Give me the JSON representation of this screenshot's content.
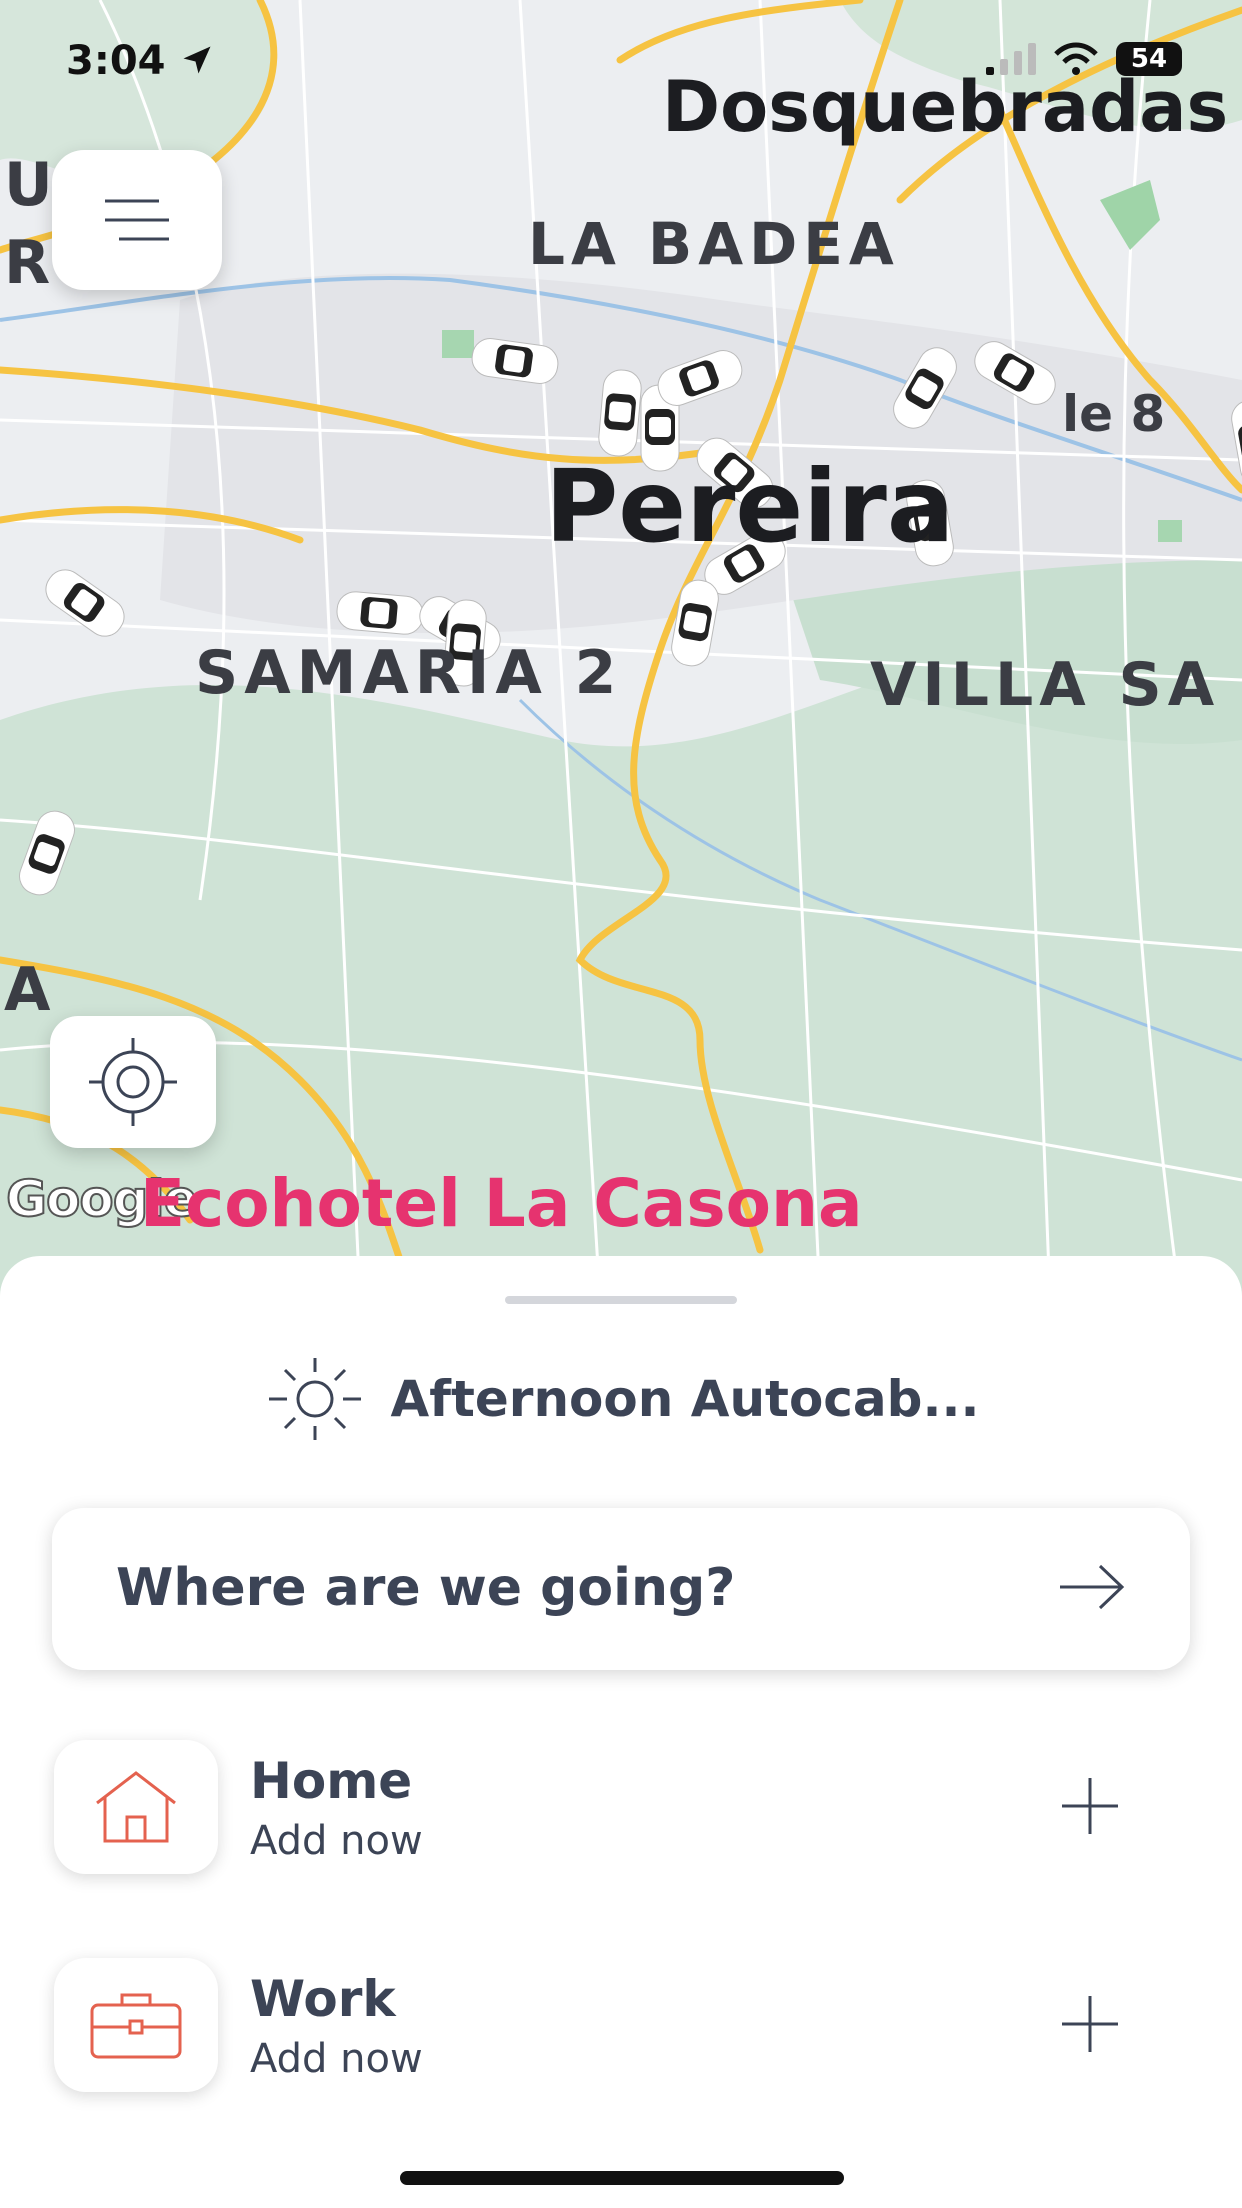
{
  "status_bar": {
    "time": "3:04",
    "battery": "54"
  },
  "map": {
    "labels": {
      "city_top_right": "Dosquebradas",
      "la_badea": "LA BADEA",
      "city_center": "Pereira",
      "samaria": "SAMARIA 2",
      "villa": "VILLA SA",
      "street": "le 8",
      "edge_u": "U",
      "edge_r": "R",
      "edge_a": "A"
    },
    "google": "Google",
    "poi": "Ecohotel La Casona"
  },
  "sheet": {
    "greeting": "Afternoon Autocab...",
    "search_placeholder": "Where are we going?",
    "places": [
      {
        "title": "Home",
        "subtitle": "Add now",
        "icon": "home-icon"
      },
      {
        "title": "Work",
        "subtitle": "Add now",
        "icon": "briefcase-icon"
      }
    ]
  },
  "colors": {
    "accent": "#e6336f",
    "text": "#3c4456",
    "road": "#f6c342",
    "icon": "#e4624f"
  }
}
